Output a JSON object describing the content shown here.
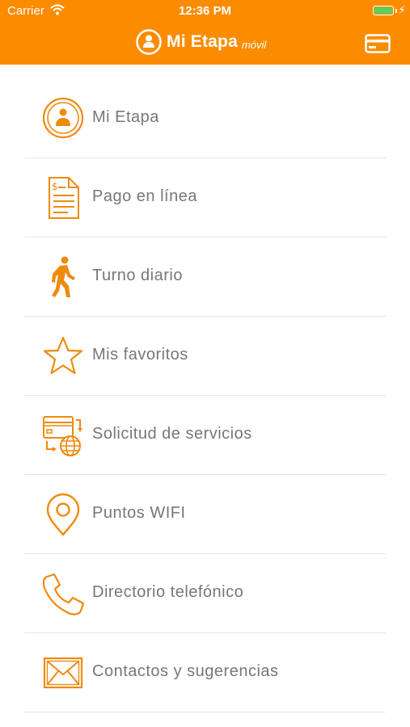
{
  "status_bar": {
    "carrier": "Carrier",
    "time": "12:36 PM",
    "battery_color": "#58d15a"
  },
  "header": {
    "background": "#fb8c00",
    "app_name": "Mi Etapa",
    "app_suffix": "móvil",
    "logo_icon": "person-circle-icon",
    "action_icon": "credit-card-icon"
  },
  "accent_color": "#f08a0c",
  "menu": {
    "items": [
      {
        "label": "Mi Etapa",
        "icon": "person-circle-icon"
      },
      {
        "label": "Pago en línea",
        "icon": "invoice-document-icon"
      },
      {
        "label": "Turno diario",
        "icon": "walking-person-icon"
      },
      {
        "label": "Mis favoritos",
        "icon": "star-icon"
      },
      {
        "label": "Solicitud de servicios",
        "icon": "service-request-globe-icon"
      },
      {
        "label": "Puntos WIFI",
        "icon": "map-pin-icon"
      },
      {
        "label": "Directorio telefónico",
        "icon": "phone-icon"
      },
      {
        "label": "Contactos y sugerencias",
        "icon": "envelope-icon"
      }
    ]
  }
}
